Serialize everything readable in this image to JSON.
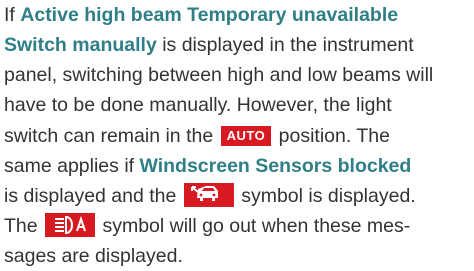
{
  "paragraph": {
    "line1": {
      "prefix": "If ",
      "bold": "Active high beam Temporary unavailable"
    },
    "line2": {
      "bold": "Switch manually",
      "suffix": " is displayed in the instrument"
    },
    "line3": {
      "text": "panel, switching between high and low beams will"
    },
    "line4": {
      "text": "have to be done manually. However, the light"
    },
    "line5": {
      "before": "switch can remain in the ",
      "after": " position. The"
    },
    "line6": {
      "prefix": "same applies if ",
      "bold": "Windscreen Sensors blocked"
    },
    "line7": {
      "before": "is displayed and the ",
      "after": " symbol is displayed."
    },
    "line8": {
      "before": "The ",
      "after": " symbol will go out when these mes-"
    },
    "line9": {
      "text": "sages are displayed."
    }
  },
  "badges": {
    "auto_label": "AUTO",
    "windscreen_symbol_icon": "windscreen-sensor-icon",
    "beam_symbol_icon": "active-high-beam-icon",
    "badge_color": "#d71a21"
  },
  "colors": {
    "highlight": "#2f7f86",
    "body_text": "#333333"
  }
}
